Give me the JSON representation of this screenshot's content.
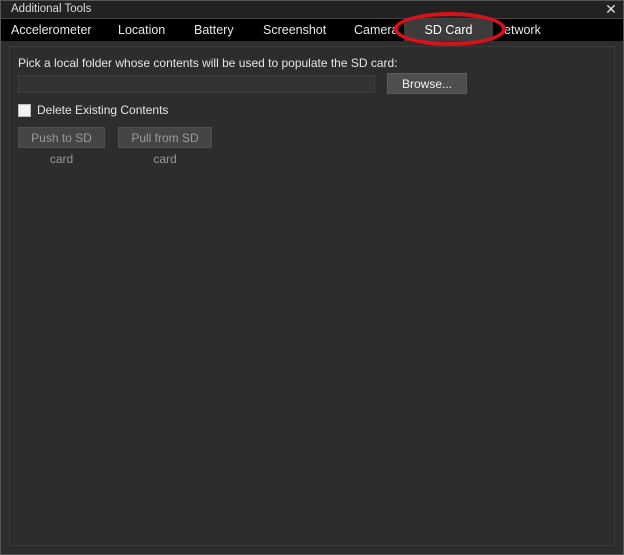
{
  "window": {
    "title": "Additional Tools",
    "close_label": "✕"
  },
  "tabs": [
    {
      "label": "Accelerometer",
      "active": false
    },
    {
      "label": "Location",
      "active": false
    },
    {
      "label": "Battery",
      "active": false
    },
    {
      "label": "Screenshot",
      "active": false
    },
    {
      "label": "Camera",
      "active": false
    },
    {
      "label": "SD Card",
      "active": true
    },
    {
      "label": "Network",
      "active": false
    }
  ],
  "sdcard": {
    "instruction": "Pick a local folder whose contents will be used to populate the SD card:",
    "path_value": "",
    "browse_label": "Browse...",
    "delete_label": "Delete Existing Contents",
    "delete_checked": false,
    "push_label": "Push to SD card",
    "pull_label": "Pull from SD card"
  },
  "colors": {
    "highlight": "#d8111b",
    "background": "#2d2d2d",
    "tabbar": "#000000"
  }
}
